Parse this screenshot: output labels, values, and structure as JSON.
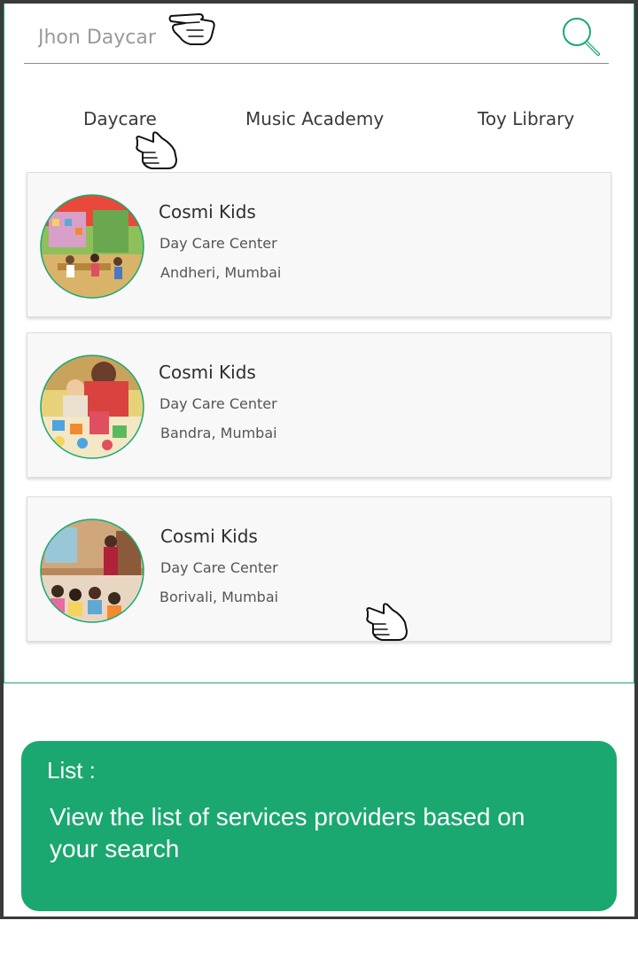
{
  "search": {
    "placeholder": "Jhon Daycar",
    "icon": "search-icon",
    "accent": "#1aa870"
  },
  "tabs": [
    {
      "label": "Daycare"
    },
    {
      "label": "Music Academy"
    },
    {
      "label": "Toy Library"
    }
  ],
  "providers": [
    {
      "name": "Cosmi Kids",
      "type": "Day Care Center",
      "location": "Andheri, Mumbai"
    },
    {
      "name": "Cosmi Kids",
      "type": "Day Care Center",
      "location": "Bandra, Mumbai"
    },
    {
      "name": "Cosmi Kids",
      "type": "Day Care Center",
      "location": "Borivali, Mumbai"
    }
  ],
  "annotation": {
    "title": "List :",
    "text": "View the list of services providers based on your search",
    "color": "#1aa870"
  }
}
